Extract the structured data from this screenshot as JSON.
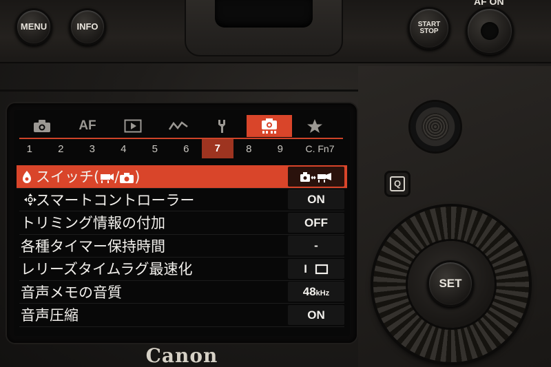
{
  "camera": {
    "buttons": {
      "menu": "MENU",
      "info": "INFO",
      "start_stop_line1": "START",
      "start_stop_line2": "STOP",
      "af_on": "AF ON",
      "set": "SET",
      "q": "Q"
    },
    "brand": "Canon"
  },
  "screen": {
    "tabs": [
      {
        "icon": "camera-icon",
        "label": ""
      },
      {
        "icon": "af-text",
        "label": "AF"
      },
      {
        "icon": "playback-icon",
        "label": ""
      },
      {
        "icon": "wave-icon",
        "label": ""
      },
      {
        "icon": "wrench-icon",
        "label": ""
      },
      {
        "icon": "custom-function-camera-icon",
        "label": "",
        "active": true
      },
      {
        "icon": "star-icon",
        "label": ""
      }
    ],
    "pages": [
      "1",
      "2",
      "3",
      "4",
      "5",
      "6",
      "7",
      "8",
      "9",
      "C. Fn7"
    ],
    "active_page": "7",
    "items": [
      {
        "label": "スイッチ(",
        "label_tail": "/",
        "label_end": ")",
        "value": "",
        "value_icon": "camera-to-movie-icon",
        "selected": true
      },
      {
        "label": "スマートコントローラー",
        "value": "ON"
      },
      {
        "label": "トリミング情報の付加",
        "value": "OFF"
      },
      {
        "label": "各種タイマー保持時間",
        "value": "-"
      },
      {
        "label": "レリーズタイムラグ最速化",
        "value": "I",
        "value_icon": "square-outline-icon"
      },
      {
        "label": "音声メモの音質",
        "value": "48",
        "value_unit": "kHz"
      },
      {
        "label": "音声圧縮",
        "value": "ON"
      }
    ],
    "colors": {
      "accent": "#d9452a",
      "accent_dark": "#9e3420",
      "background": "#080808",
      "text": "#f2f0ec"
    }
  }
}
